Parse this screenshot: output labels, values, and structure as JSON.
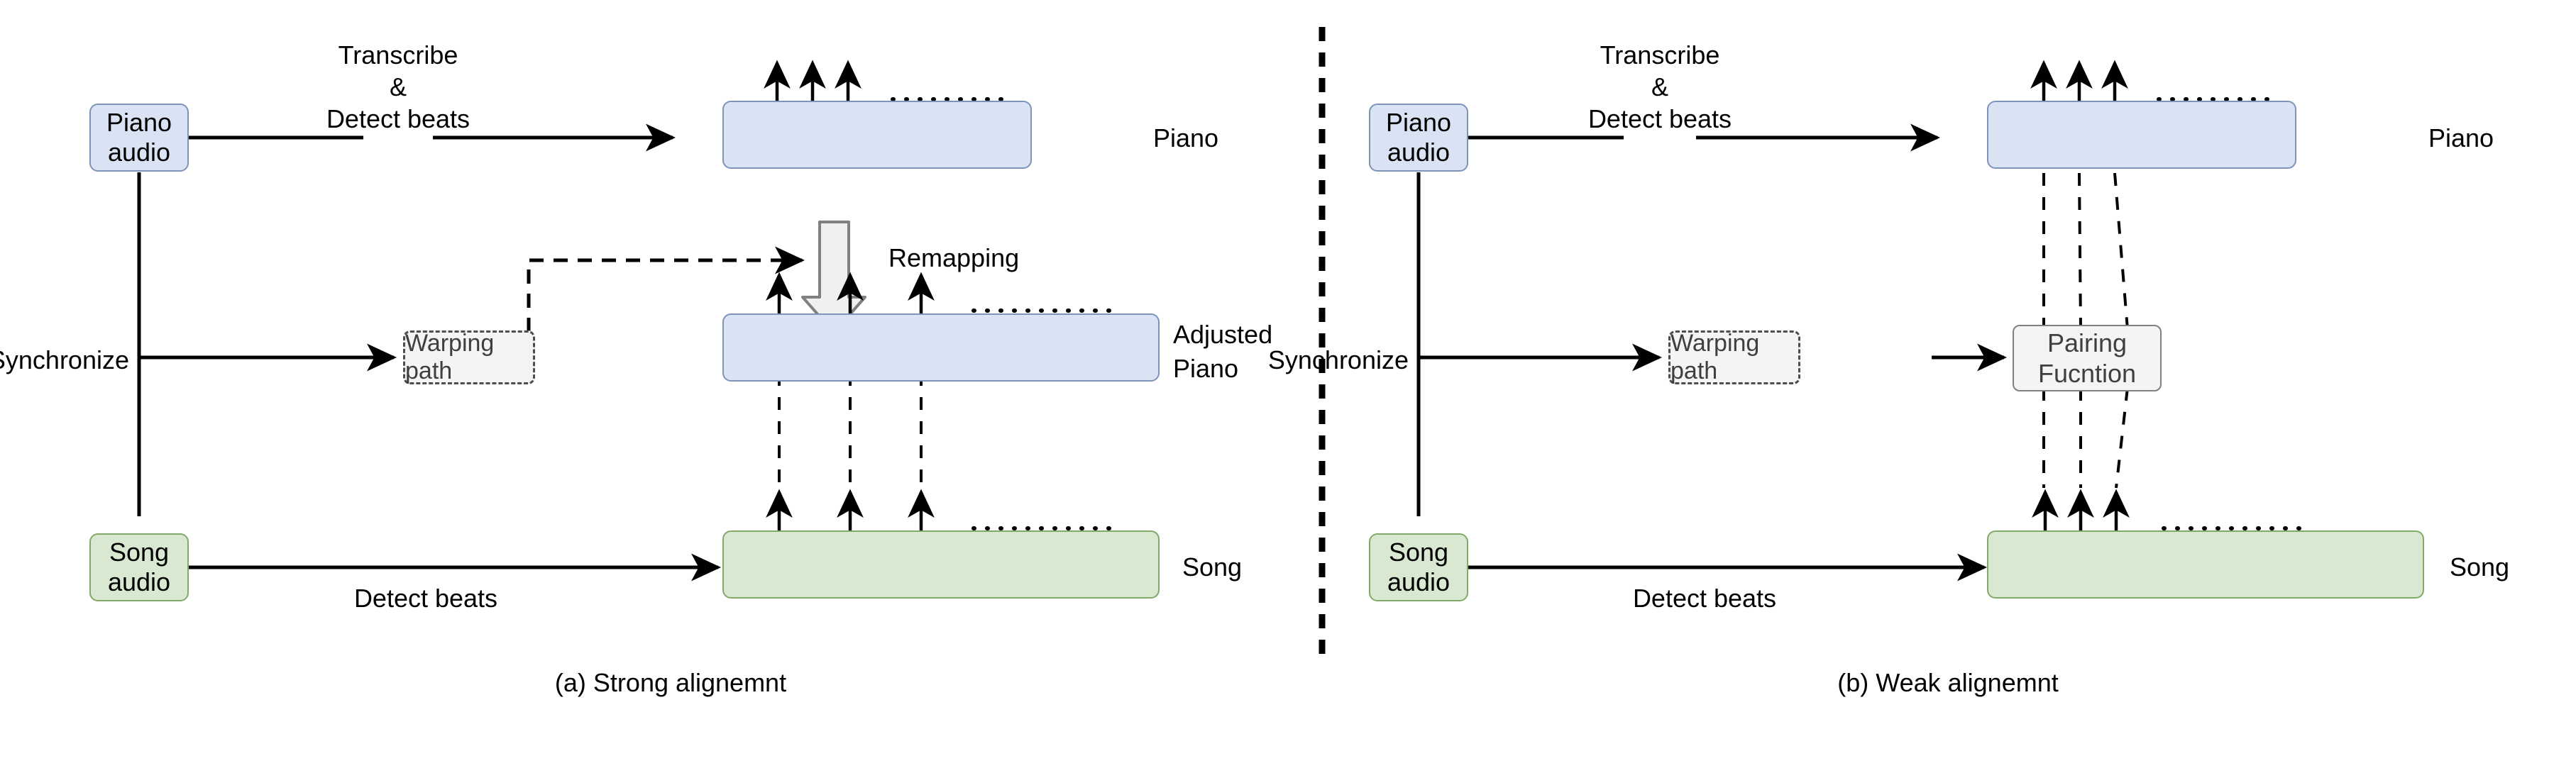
{
  "figure": {
    "type": "flow-diagram",
    "background": "#ffffff",
    "colors": {
      "piano_fill": "#dae3f3",
      "piano_stroke": "#7d93b8",
      "song_fill": "#d9e8d0",
      "song_stroke": "#82a86a",
      "neutral_fill": "#f4f4f4",
      "neutral_stroke": "#808080",
      "dashed_stroke": "#4d4d4d",
      "line": "#000000",
      "remap_arrow_fill": "#f0f0f0"
    }
  },
  "panels": [
    {
      "id": "a",
      "caption": "(a) Strong alignemnt",
      "nodes": {
        "piano_audio": "Piano\naudio",
        "piano_audio_line1": "Piano",
        "piano_audio_line2": "audio",
        "song_audio_line1": "Song",
        "song_audio_line2": "audio",
        "warping_path": "Warping path"
      },
      "edge_labels": {
        "transcribe_line1": "Transcribe",
        "transcribe_line2": "&",
        "transcribe_line3": "Detect beats",
        "synchronize": "Synchronize",
        "detect_beats": "Detect beats",
        "remapping": "Remapping"
      },
      "track_labels": {
        "piano": "Piano",
        "adjusted_piano_line1": "Adjusted",
        "adjusted_piano_line2": "Piano",
        "song": "Song"
      },
      "tracks": [
        {
          "name": "piano",
          "beats": 3,
          "ellipsis_dots": 9,
          "color": "blue"
        },
        {
          "name": "adjusted-piano",
          "beats": 3,
          "ellipsis_dots": 12,
          "color": "blue"
        },
        {
          "name": "song",
          "beats": 3,
          "ellipsis_dots": 12,
          "color": "green"
        }
      ]
    },
    {
      "id": "b",
      "caption": "(b) Weak alignemnt",
      "nodes": {
        "piano_audio_line1": "Piano",
        "piano_audio_line2": "audio",
        "song_audio_line1": "Song",
        "song_audio_line2": "audio",
        "warping_path": "Warping path",
        "pairing_function_line1": "Pairing",
        "pairing_function_line2": "Fucntion"
      },
      "edge_labels": {
        "transcribe_line1": "Transcribe",
        "transcribe_line2": "&",
        "transcribe_line3": "Detect beats",
        "synchronize": "Synchronize",
        "detect_beats": "Detect beats"
      },
      "track_labels": {
        "piano": "Piano",
        "song": "Song"
      },
      "tracks": [
        {
          "name": "piano",
          "beats": 3,
          "ellipsis_dots": 9,
          "color": "blue"
        },
        {
          "name": "song",
          "beats": 3,
          "ellipsis_dots": 12,
          "color": "green"
        }
      ]
    }
  ]
}
